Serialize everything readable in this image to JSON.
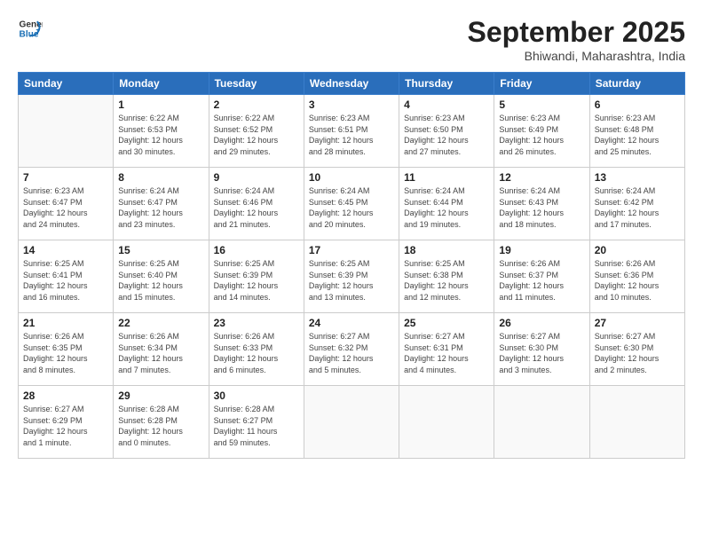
{
  "header": {
    "logo_general": "General",
    "logo_blue": "Blue",
    "month_title": "September 2025",
    "location": "Bhiwandi, Maharashtra, India"
  },
  "days_of_week": [
    "Sunday",
    "Monday",
    "Tuesday",
    "Wednesday",
    "Thursday",
    "Friday",
    "Saturday"
  ],
  "weeks": [
    [
      {
        "day": "",
        "info": ""
      },
      {
        "day": "1",
        "info": "Sunrise: 6:22 AM\nSunset: 6:53 PM\nDaylight: 12 hours\nand 30 minutes."
      },
      {
        "day": "2",
        "info": "Sunrise: 6:22 AM\nSunset: 6:52 PM\nDaylight: 12 hours\nand 29 minutes."
      },
      {
        "day": "3",
        "info": "Sunrise: 6:23 AM\nSunset: 6:51 PM\nDaylight: 12 hours\nand 28 minutes."
      },
      {
        "day": "4",
        "info": "Sunrise: 6:23 AM\nSunset: 6:50 PM\nDaylight: 12 hours\nand 27 minutes."
      },
      {
        "day": "5",
        "info": "Sunrise: 6:23 AM\nSunset: 6:49 PM\nDaylight: 12 hours\nand 26 minutes."
      },
      {
        "day": "6",
        "info": "Sunrise: 6:23 AM\nSunset: 6:48 PM\nDaylight: 12 hours\nand 25 minutes."
      }
    ],
    [
      {
        "day": "7",
        "info": "Sunrise: 6:23 AM\nSunset: 6:47 PM\nDaylight: 12 hours\nand 24 minutes."
      },
      {
        "day": "8",
        "info": "Sunrise: 6:24 AM\nSunset: 6:47 PM\nDaylight: 12 hours\nand 23 minutes."
      },
      {
        "day": "9",
        "info": "Sunrise: 6:24 AM\nSunset: 6:46 PM\nDaylight: 12 hours\nand 21 minutes."
      },
      {
        "day": "10",
        "info": "Sunrise: 6:24 AM\nSunset: 6:45 PM\nDaylight: 12 hours\nand 20 minutes."
      },
      {
        "day": "11",
        "info": "Sunrise: 6:24 AM\nSunset: 6:44 PM\nDaylight: 12 hours\nand 19 minutes."
      },
      {
        "day": "12",
        "info": "Sunrise: 6:24 AM\nSunset: 6:43 PM\nDaylight: 12 hours\nand 18 minutes."
      },
      {
        "day": "13",
        "info": "Sunrise: 6:24 AM\nSunset: 6:42 PM\nDaylight: 12 hours\nand 17 minutes."
      }
    ],
    [
      {
        "day": "14",
        "info": "Sunrise: 6:25 AM\nSunset: 6:41 PM\nDaylight: 12 hours\nand 16 minutes."
      },
      {
        "day": "15",
        "info": "Sunrise: 6:25 AM\nSunset: 6:40 PM\nDaylight: 12 hours\nand 15 minutes."
      },
      {
        "day": "16",
        "info": "Sunrise: 6:25 AM\nSunset: 6:39 PM\nDaylight: 12 hours\nand 14 minutes."
      },
      {
        "day": "17",
        "info": "Sunrise: 6:25 AM\nSunset: 6:39 PM\nDaylight: 12 hours\nand 13 minutes."
      },
      {
        "day": "18",
        "info": "Sunrise: 6:25 AM\nSunset: 6:38 PM\nDaylight: 12 hours\nand 12 minutes."
      },
      {
        "day": "19",
        "info": "Sunrise: 6:26 AM\nSunset: 6:37 PM\nDaylight: 12 hours\nand 11 minutes."
      },
      {
        "day": "20",
        "info": "Sunrise: 6:26 AM\nSunset: 6:36 PM\nDaylight: 12 hours\nand 10 minutes."
      }
    ],
    [
      {
        "day": "21",
        "info": "Sunrise: 6:26 AM\nSunset: 6:35 PM\nDaylight: 12 hours\nand 8 minutes."
      },
      {
        "day": "22",
        "info": "Sunrise: 6:26 AM\nSunset: 6:34 PM\nDaylight: 12 hours\nand 7 minutes."
      },
      {
        "day": "23",
        "info": "Sunrise: 6:26 AM\nSunset: 6:33 PM\nDaylight: 12 hours\nand 6 minutes."
      },
      {
        "day": "24",
        "info": "Sunrise: 6:27 AM\nSunset: 6:32 PM\nDaylight: 12 hours\nand 5 minutes."
      },
      {
        "day": "25",
        "info": "Sunrise: 6:27 AM\nSunset: 6:31 PM\nDaylight: 12 hours\nand 4 minutes."
      },
      {
        "day": "26",
        "info": "Sunrise: 6:27 AM\nSunset: 6:30 PM\nDaylight: 12 hours\nand 3 minutes."
      },
      {
        "day": "27",
        "info": "Sunrise: 6:27 AM\nSunset: 6:30 PM\nDaylight: 12 hours\nand 2 minutes."
      }
    ],
    [
      {
        "day": "28",
        "info": "Sunrise: 6:27 AM\nSunset: 6:29 PM\nDaylight: 12 hours\nand 1 minute."
      },
      {
        "day": "29",
        "info": "Sunrise: 6:28 AM\nSunset: 6:28 PM\nDaylight: 12 hours\nand 0 minutes."
      },
      {
        "day": "30",
        "info": "Sunrise: 6:28 AM\nSunset: 6:27 PM\nDaylight: 11 hours\nand 59 minutes."
      },
      {
        "day": "",
        "info": ""
      },
      {
        "day": "",
        "info": ""
      },
      {
        "day": "",
        "info": ""
      },
      {
        "day": "",
        "info": ""
      }
    ]
  ]
}
